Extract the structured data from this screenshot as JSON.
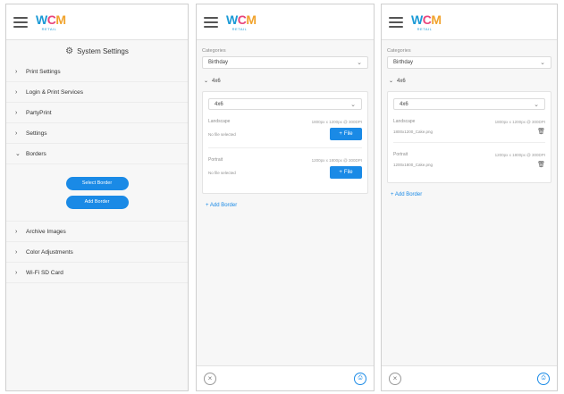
{
  "brand": {
    "logo_w": "W",
    "logo_c": "C",
    "logo_m": "M",
    "logo_sub": "RETAIL"
  },
  "settings_panel": {
    "title": "System Settings",
    "items_before": [
      {
        "label": "Print Settings",
        "expanded": false
      },
      {
        "label": "Login & Print Services",
        "expanded": false
      },
      {
        "label": "PartyPrint",
        "expanded": false
      },
      {
        "label": "Settings",
        "expanded": false
      }
    ],
    "borders": {
      "label": "Borders",
      "expanded": true,
      "select_button": "Select Border",
      "add_button": "Add Border"
    },
    "items_after": [
      {
        "label": "Archive Images",
        "expanded": false
      },
      {
        "label": "Color Adjustments",
        "expanded": false
      },
      {
        "label": "Wi-Fi SD Card",
        "expanded": false
      }
    ]
  },
  "border_panel_empty": {
    "category_label": "Categories",
    "category_value": "Birthday",
    "group_title": "4x6",
    "size_value": "4x6",
    "slots": [
      {
        "name": "Landscape",
        "resolution": "1800px x 1200px @ 300DPI",
        "file": "No file selected",
        "button": "File"
      },
      {
        "name": "Portrait",
        "resolution": "1200px x 1800px @ 300DPI",
        "file": "No file selected",
        "button": "File"
      }
    ],
    "add_border": "Add Border"
  },
  "border_panel_filled": {
    "category_label": "Categories",
    "category_value": "Birthday",
    "group_title": "4x6",
    "size_value": "4x6",
    "slots": [
      {
        "name": "Landscape",
        "resolution": "1800px x 1200px @ 300DPI",
        "file": "1800x1200_Cake.png"
      },
      {
        "name": "Portrait",
        "resolution": "1200px x 1800px @ 300DPI",
        "file": "1200x1800_Cake.png"
      }
    ],
    "add_border": "Add Border"
  },
  "icons": {
    "chevron_right": "›",
    "chevron_down": "⌄",
    "close": "×",
    "save": "⎙",
    "trash": "🗑",
    "plus": "+",
    "gear": "⚙"
  },
  "colors": {
    "accent": "#1a8ae6",
    "logo_blue": "#1b9ad6",
    "logo_pink": "#e8447c",
    "logo_orange": "#f1a32c"
  }
}
